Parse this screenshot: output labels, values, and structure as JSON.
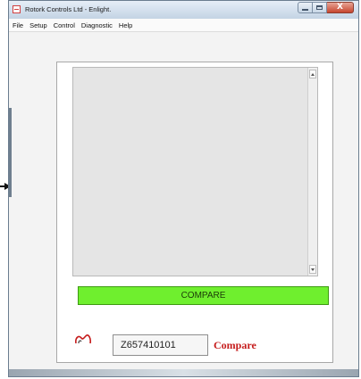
{
  "window": {
    "title": "Rotork Controls Ltd - Enlight.",
    "close_glyph": "X"
  },
  "menu": [
    "File",
    "Setup",
    "Control",
    "Diagnostic",
    "Help"
  ],
  "main": {
    "output_text": "",
    "compare_button_label": "COMPARE",
    "compare_button_color": "#6fef2e",
    "serial_number": "Z657410101",
    "compare_label": "Compare",
    "compare_label_color": "#c51b1b",
    "logo_icon": "rotork-logo-icon"
  },
  "icons": {
    "app": "app-icon",
    "minimize": "minimize-icon",
    "maximize": "maximize-icon",
    "close": "close-icon",
    "scroll_up": "scroll-up-icon",
    "scroll_down": "scroll-down-icon",
    "pointer": "arrow-pointer-icon"
  }
}
